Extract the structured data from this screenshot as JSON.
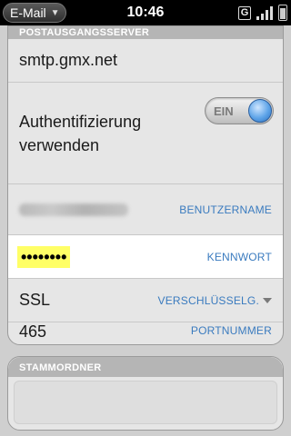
{
  "statusbar": {
    "app_name": "E-Mail",
    "time": "10:46",
    "network_badge": "G",
    "icons": [
      "chevron-down-icon",
      "network-g-icon",
      "signal-bars-icon",
      "battery-icon"
    ]
  },
  "outgoing": {
    "header": "POSTAUSGANGSSERVER",
    "server": "smtp.gmx.net",
    "auth_label": "Authentifizierung verwenden",
    "auth_toggle": "EIN",
    "username_label": "BENUTZERNAME",
    "password_value": "••••••••",
    "password_label": "KENNWORT",
    "encryption_value": "SSL",
    "encryption_label": "VERSCHLÜSSELG.",
    "port_value": "465",
    "port_label": "PORTNUMMER"
  },
  "root_folder": {
    "header": "STAMMORDNER"
  },
  "colors": {
    "accent_label": "#3a7bbf",
    "toggle_knob": "#5ea4e8",
    "password_highlight": "#ffff66"
  }
}
